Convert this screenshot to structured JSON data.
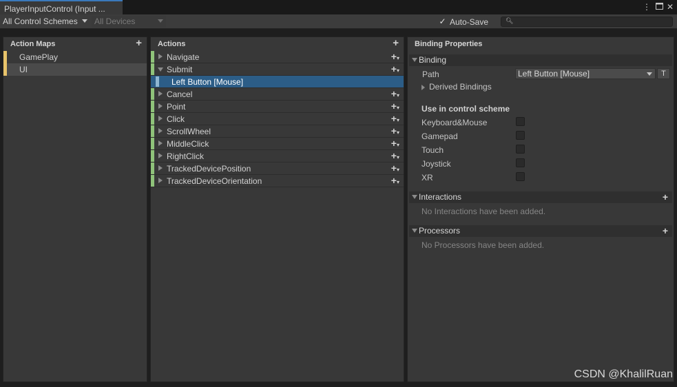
{
  "window": {
    "tab_title": "PlayerInputControl (Input ...",
    "menu_icon": "kebab-menu-icon",
    "maximize_icon": "maximize-icon",
    "close_icon": "close-icon"
  },
  "toolbar": {
    "control_schemes": "All Control Schemes",
    "devices": "All Devices",
    "autosave_label": "Auto-Save",
    "autosave_checked": true,
    "search_value": ""
  },
  "action_maps": {
    "header": "Action Maps",
    "items": [
      {
        "label": "GamePlay",
        "selected": false
      },
      {
        "label": "UI",
        "selected": true
      }
    ]
  },
  "actions": {
    "header": "Actions",
    "items": [
      {
        "label": "Navigate",
        "expanded": false
      },
      {
        "label": "Submit",
        "expanded": true
      },
      {
        "label": "Cancel",
        "expanded": false
      },
      {
        "label": "Point",
        "expanded": false
      },
      {
        "label": "Click",
        "expanded": false
      },
      {
        "label": "ScrollWheel",
        "expanded": false
      },
      {
        "label": "MiddleClick",
        "expanded": false
      },
      {
        "label": "RightClick",
        "expanded": false
      },
      {
        "label": "TrackedDevicePosition",
        "expanded": false
      },
      {
        "label": "TrackedDeviceOrientation",
        "expanded": false
      }
    ],
    "selected_binding": "Left Button [Mouse]"
  },
  "binding_properties": {
    "header": "Binding Properties",
    "binding_section": "Binding",
    "path_label": "Path",
    "path_value": "Left Button [Mouse]",
    "t_button": "T",
    "derived_bindings": "Derived Bindings",
    "use_in_scheme": "Use in control scheme",
    "schemes": [
      {
        "label": "Keyboard&Mouse",
        "checked": false
      },
      {
        "label": "Gamepad",
        "checked": false
      },
      {
        "label": "Touch",
        "checked": false
      },
      {
        "label": "Joystick",
        "checked": false
      },
      {
        "label": "XR",
        "checked": false
      }
    ],
    "interactions_section": "Interactions",
    "interactions_empty": "No Interactions have been added.",
    "processors_section": "Processors",
    "processors_empty": "No Processors have been added."
  },
  "watermark": "CSDN @KhalilRuan",
  "colors": {
    "map_stripe": "#e8c36a",
    "action_stripe": "#8fc37a",
    "selection": "#2c5d87",
    "tab_accent": "#3a79bb"
  }
}
